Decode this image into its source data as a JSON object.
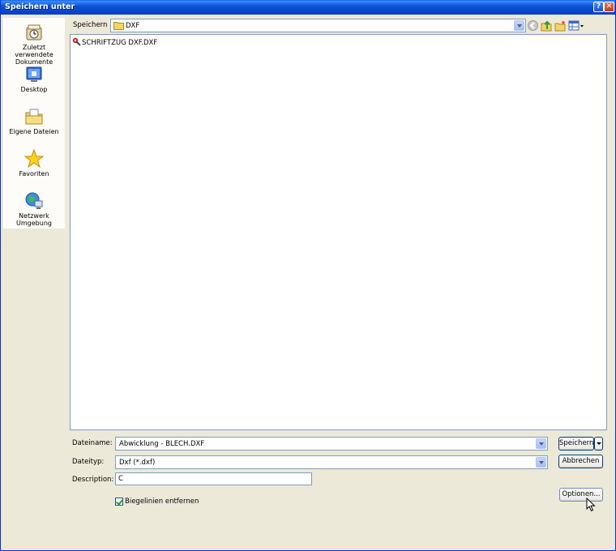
{
  "window": {
    "title": "Speichern unter",
    "help_label": "?",
    "close_label": "✕"
  },
  "places": [
    {
      "label": "Zuletzt verwendete Dokumente",
      "icon": "recent-documents-icon"
    },
    {
      "label": "Desktop",
      "icon": "desktop-icon"
    },
    {
      "label": "Eigene Dateien",
      "icon": "my-documents-icon"
    },
    {
      "label": "Favoriten",
      "icon": "favorites-star-icon"
    },
    {
      "label": "Netzwerk Umgebung",
      "icon": "network-globe-icon"
    }
  ],
  "lookin": {
    "label": "Speichern",
    "value": "DXF"
  },
  "toolbar": {
    "icons": [
      "back-icon",
      "up-folder-icon",
      "new-folder-icon",
      "view-menu-icon"
    ]
  },
  "files": [
    {
      "name": "SCHRIFTZUG DXF.DXF",
      "icon": "dxf-file-icon"
    }
  ],
  "form": {
    "filename_label": "Dateiname:",
    "filename_value": "Abwicklung - BLECH.DXF",
    "filetype_label": "Dateityp:",
    "filetype_value": "Dxf (*.dxf)",
    "description_label": "Description:",
    "description_value": "C",
    "save_label": "Speichern",
    "cancel_label": "Abbrechen",
    "options_label": "Optionen...",
    "checkbox_label": "Biegelinien entfernen",
    "checkbox_checked": true
  }
}
